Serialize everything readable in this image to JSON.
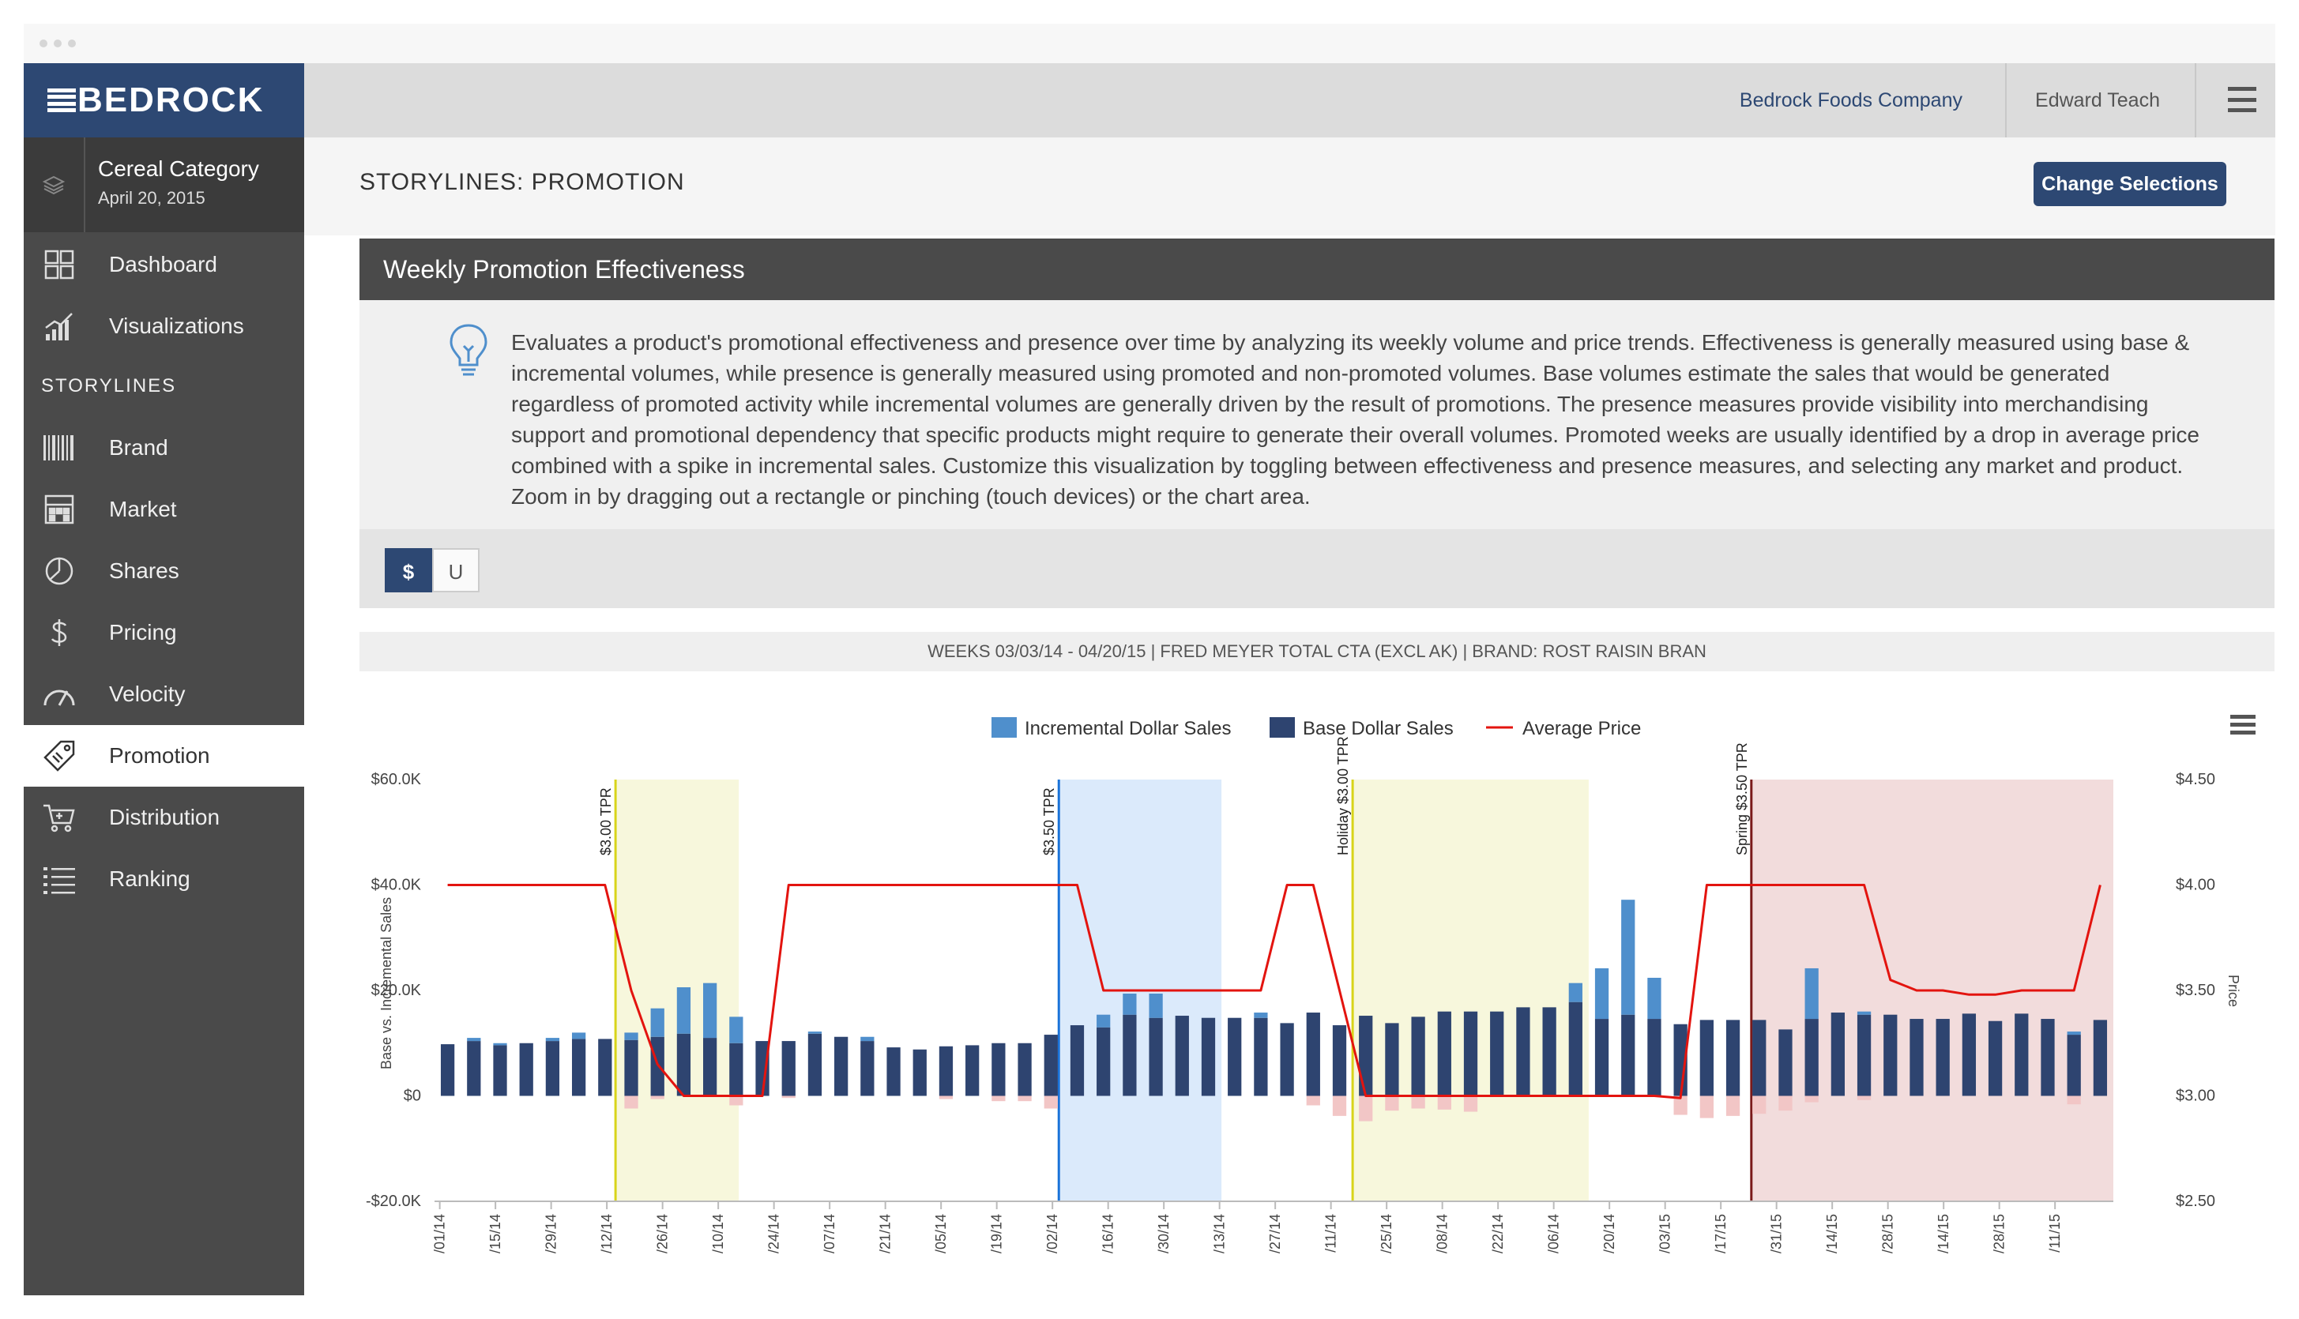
{
  "app": {
    "logo": "BEDROCK"
  },
  "category": {
    "title": "Cereal Category",
    "date": "April 20, 2015"
  },
  "sidebar": {
    "top_items": [
      {
        "label": "Dashboard",
        "icon": "dashboard-icon"
      },
      {
        "label": "Visualizations",
        "icon": "bar-chart-icon"
      }
    ],
    "section_label": "STORYLINES",
    "storyline_items": [
      {
        "label": "Brand",
        "icon": "barcode-icon"
      },
      {
        "label": "Market",
        "icon": "building-icon"
      },
      {
        "label": "Shares",
        "icon": "pie-chart-icon"
      },
      {
        "label": "Pricing",
        "icon": "dollar-icon"
      },
      {
        "label": "Velocity",
        "icon": "speedometer-icon"
      },
      {
        "label": "Promotion",
        "icon": "price-tag-icon",
        "active": true
      },
      {
        "label": "Distribution",
        "icon": "cart-icon"
      },
      {
        "label": "Ranking",
        "icon": "list-icon"
      }
    ]
  },
  "header": {
    "company": "Bedrock Foods Company",
    "user": "Edward Teach"
  },
  "page": {
    "title": "STORYLINES: PROMOTION",
    "change_button": "Change Selections"
  },
  "panel": {
    "title": "Weekly Promotion Effectiveness",
    "description": "Evaluates a product's promotional effectiveness and presence over time by analyzing its weekly volume and price trends. Effectiveness is generally measured using base & incremental volumes, while presence is generally measured using promoted and non-promoted volumes. Base volumes estimate the sales that would be generated regardless of promoted activity while incremental volumes are generally driven by the result of promotions. The presence measures provide visibility into merchandising support and promotional dependency that specific products might require to generate their overall volumes. Promoted weeks are usually identified by a drop in average price combined with a spike in incremental sales. Customize this visualization by toggling between effectiveness and presence measures, and selecting any market and product. Zoom in by dragging out a rectangle or pinching (touch devices) or the chart area.",
    "toggle": {
      "dollars": "$",
      "units": "U",
      "selected": "$"
    },
    "info": "WEEKS 03/03/14 - 04/20/15  | FRED MEYER TOTAL CTA (EXCL AK)  | BRAND: ROST RAISIN BRAN"
  },
  "colors": {
    "base": "#2e4470",
    "incremental": "#4f8fcc",
    "negative": "#f2c6c6",
    "price": "#e3140f",
    "brand": "#2d4873"
  },
  "chart_data": {
    "type": "bar",
    "legend": [
      "Incremental Dollar Sales",
      "Base Dollar Sales",
      "Average Price"
    ],
    "legend_position": "top-center",
    "ylabel": "Base vs. Incremental Sales",
    "y2label": "Price",
    "ylim": [
      -20000,
      60000
    ],
    "y_ticks": [
      "-$20.0K",
      "$0",
      "$20.0K",
      "$40.0K",
      "$60.0K"
    ],
    "y2lim": [
      2.5,
      4.5
    ],
    "y2_ticks": [
      "$2.50",
      "$3.00",
      "$3.50",
      "$4.00",
      "$4.50"
    ],
    "x_tick_labels": [
      "/01/14",
      "/15/14",
      "/29/14",
      "/12/14",
      "/26/14",
      "/10/14",
      "/24/14",
      "/07/14",
      "/21/14",
      "/05/14",
      "/19/14",
      "/02/14",
      "/16/14",
      "/30/14",
      "/13/14",
      "/27/14",
      "/11/14",
      "/25/14",
      "/08/14",
      "/22/14",
      "/06/14",
      "/20/14",
      "/03/15",
      "/17/15",
      "/31/15",
      "/14/15",
      "/28/15",
      "/14/15",
      "/28/15",
      "/11/15"
    ],
    "base": [
      9800,
      10400,
      9600,
      10000,
      10400,
      10800,
      10800,
      10600,
      11200,
      11800,
      11000,
      10000,
      10400,
      10400,
      11800,
      11200,
      10400,
      9200,
      8800,
      9400,
      9600,
      10000,
      10000,
      11600,
      13400,
      13000,
      15400,
      14800,
      15200,
      14800,
      14800,
      14800,
      13800,
      15800,
      13400,
      15200,
      13800,
      15000,
      16000,
      16000,
      16000,
      16800,
      16800,
      17800,
      14600,
      15400,
      14600,
      13600,
      14400,
      14400,
      14400,
      12600,
      14600,
      15800,
      15400,
      15400,
      14600,
      14600,
      15600,
      14200,
      15600,
      14600,
      11600,
      14400
    ],
    "incremental": [
      0,
      600,
      400,
      0,
      600,
      1200,
      0,
      1400,
      5400,
      8800,
      10400,
      5000,
      0,
      0,
      400,
      0,
      800,
      0,
      0,
      0,
      0,
      0,
      0,
      0,
      0,
      2400,
      4000,
      4600,
      0,
      0,
      0,
      1000,
      0,
      0,
      0,
      0,
      0,
      0,
      0,
      0,
      0,
      0,
      0,
      3600,
      9600,
      21800,
      7800,
      0,
      0,
      0,
      0,
      0,
      9600,
      0,
      600,
      0,
      0,
      0,
      0,
      0,
      0,
      0,
      600,
      0
    ],
    "negative": [
      0,
      0,
      0,
      0,
      0,
      0,
      0,
      -2400,
      -600,
      0,
      0,
      -1800,
      0,
      -400,
      0,
      0,
      0,
      0,
      0,
      -600,
      0,
      -1000,
      -1000,
      -2400,
      0,
      0,
      0,
      0,
      0,
      0,
      0,
      0,
      0,
      -1800,
      -3800,
      -4800,
      -2800,
      -2400,
      -2600,
      -3000,
      0,
      0,
      0,
      0,
      0,
      0,
      0,
      -3600,
      -4200,
      -3800,
      -3400,
      -2800,
      -1200,
      0,
      -800,
      0,
      0,
      0,
      0,
      0,
      0,
      0,
      -1600,
      0
    ],
    "price": [
      4.0,
      4.0,
      4.0,
      4.0,
      4.0,
      4.0,
      4.0,
      3.5,
      3.15,
      3.0,
      3.0,
      3.0,
      3.0,
      4.0,
      4.0,
      4.0,
      4.0,
      4.0,
      4.0,
      4.0,
      4.0,
      4.0,
      4.0,
      4.0,
      4.0,
      3.5,
      3.5,
      3.5,
      3.5,
      3.5,
      3.5,
      3.5,
      4.0,
      4.0,
      3.5,
      3.0,
      3.0,
      3.0,
      3.0,
      3.0,
      3.0,
      3.0,
      3.0,
      3.0,
      3.0,
      3.0,
      3.0,
      2.99,
      4.0,
      4.0,
      4.0,
      4.0,
      4.0,
      4.0,
      4.0,
      3.55,
      3.5,
      3.5,
      3.48,
      3.48,
      3.5,
      3.5,
      3.5,
      4.0
    ],
    "promotions": [
      {
        "label": "$3.00 TPR",
        "color": "#d8d41a",
        "shade": "#f7f7dc"
      },
      {
        "label": "$3.50 TPR",
        "color": "#1a73d8",
        "shade": "#dbeafb"
      },
      {
        "label": "Holiday $3.00 TPR",
        "color": "#d8d41a",
        "shade": "#f7f7dc"
      },
      {
        "label": "Spring $3.50 TPR",
        "color": "#7a1a1a",
        "shade": "#f2dcdc"
      }
    ]
  }
}
